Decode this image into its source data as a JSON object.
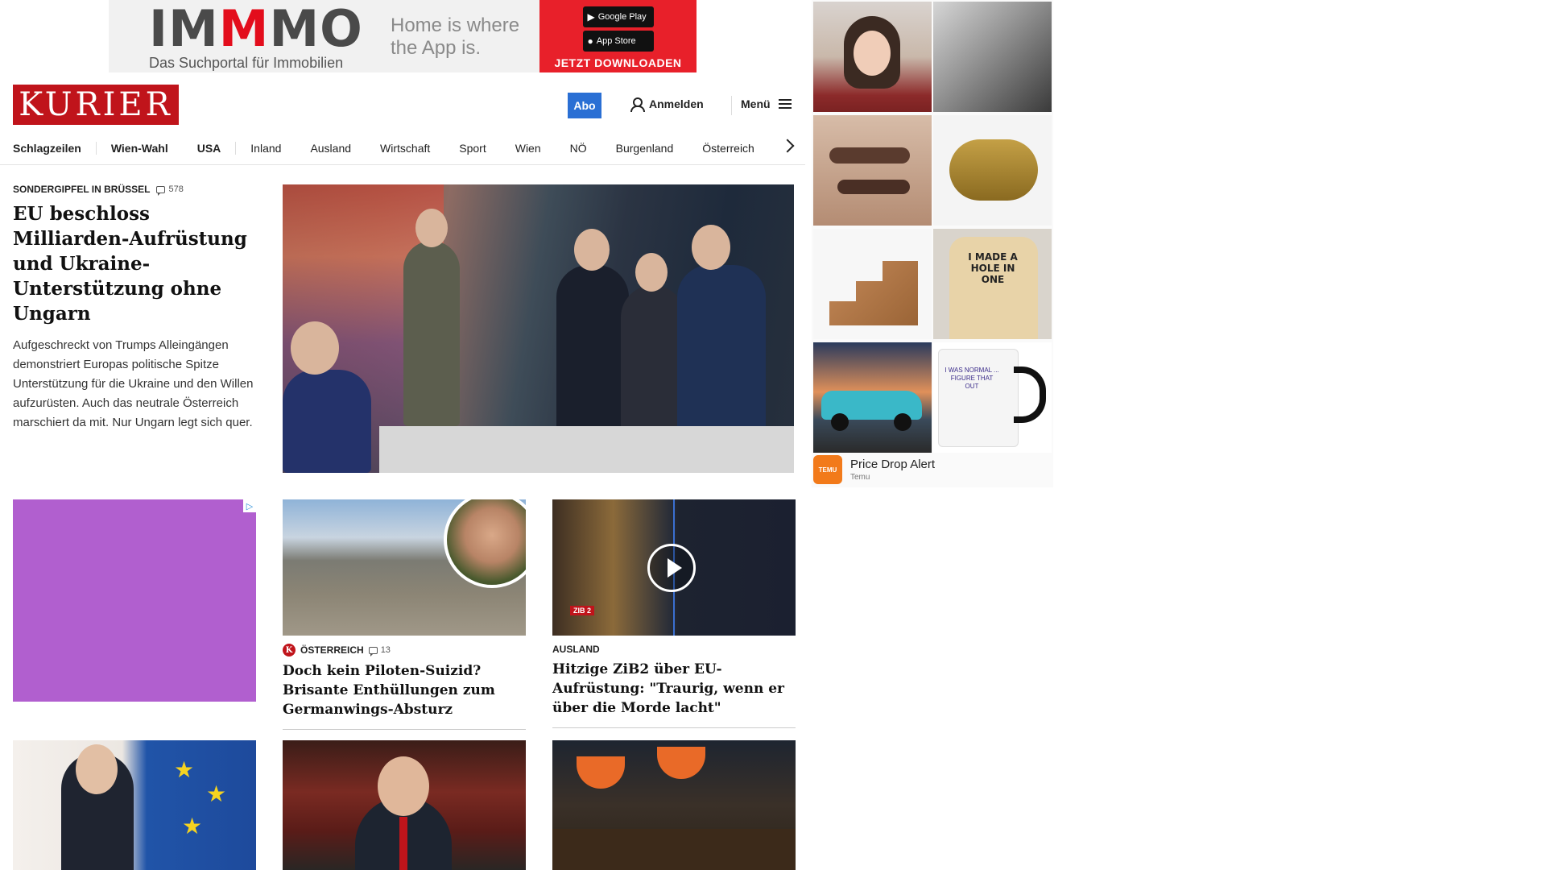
{
  "top_ad": {
    "logo_pre": "IM",
    "logo_m": "M",
    "logo_post": "MO",
    "subtitle": "Das Suchportal für Immobilien",
    "claim_line1": "Home is where",
    "claim_line2": "the App is.",
    "google_play": "Google Play",
    "app_store": "App Store",
    "cta": "JETZT DOWNLOADEN"
  },
  "header": {
    "logo": "KURIER",
    "abo": "Abo",
    "login": "Anmelden",
    "menu": "Menü"
  },
  "nav": {
    "items": [
      "Schlagzeilen",
      "Wien-Wahl",
      "USA",
      "Inland",
      "Ausland",
      "Wirtschaft",
      "Sport",
      "Wien",
      "NÖ",
      "Burgenland",
      "Österreich"
    ]
  },
  "lead": {
    "kicker": "SONDERGIPFEL IN BRÜSSEL",
    "comments": "578",
    "title": "EU beschloss Milliarden-Aufrüstung und Ukraine-Unterstützung ohne Ungarn",
    "teaser": "Aufgeschreckt von Trumps Alleingängen demonstriert Europas politische Spitze Unterstützung für die Ukraine und den Willen aufzurüsten. Auch das neutrale Österreich marschiert da mit. Nur Ungarn legt sich quer."
  },
  "cards": [
    {
      "badge": "K",
      "section": "ÖSTERREICH",
      "comments": "13",
      "title": "Doch kein Piloten-Suizid? Brisante Enthüllungen zum Germanwings-Absturz"
    },
    {
      "section": "AUSLAND",
      "video_label": "ZIB 2",
      "title": "Hitzige ZiB2 über EU-Aufrüstung: \"Traurig, wenn er über die Morde lacht\""
    }
  ],
  "right_ad": {
    "shirt_text": "I MADE A HOLE IN ONE",
    "mug_text": "I WAS NORMAL ... FIGURE THAT OUT",
    "title": "Price Drop Alert",
    "advertiser": "Temu",
    "logo_text": "TEMU"
  },
  "colors": {
    "brand_red": "#c0141b",
    "abo_blue": "#2a6fd4",
    "ad_purple": "#b15fcf",
    "temu_orange": "#f27a1a"
  }
}
